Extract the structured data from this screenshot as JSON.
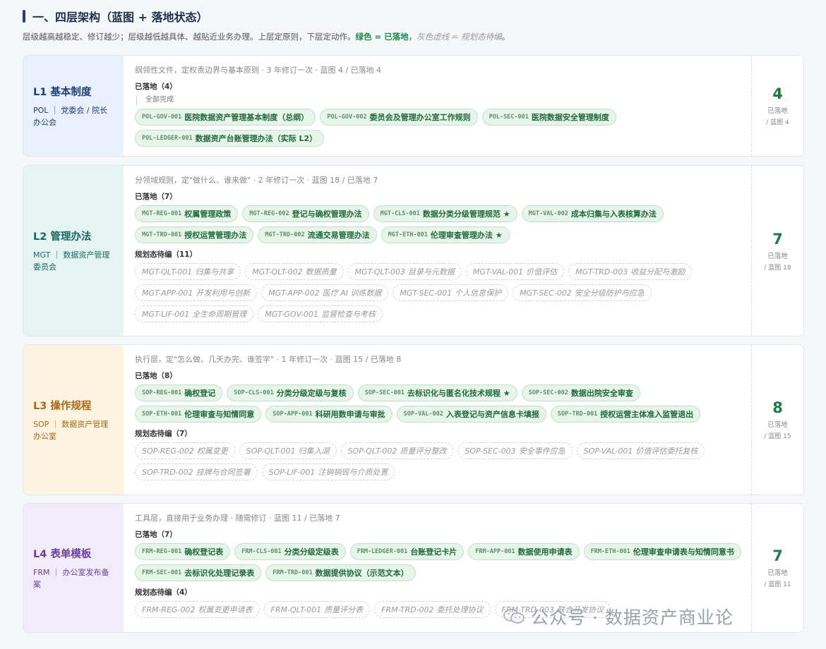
{
  "header": {
    "title": "一、四层架构（蓝图 + 落地状态）",
    "subtitle_prefix": "层级越高越稳定、修订越少；层级越低越具体、越贴近业务办理。上层定原则，下层定动作。",
    "subtitle_green": "绿色 = 已落地",
    "subtitle_sep": "，",
    "subtitle_gray": "灰色虚线 = 规划态待编",
    "subtitle_end": "。"
  },
  "colors": {
    "l1_bg": "#eaf0fb",
    "l1_fg": "#1f3f7a",
    "l2_bg": "#e6f4f1",
    "l2_fg": "#17695e",
    "l3_bg": "#fdf3e1",
    "l3_fg": "#a6691a",
    "l4_bg": "#f1ecf7",
    "l4_fg": "#6b3f9a",
    "done_green": "#1e7a45"
  },
  "layers": [
    {
      "name": "L1 基本制度",
      "owner": "POL ｜ 党委会 / 院长办公会",
      "desc": "纲领性文件，定权责边界与基本原则 · 3 年修订一次 · 蓝图 4 / 已落地 4",
      "done_label": "已落地（4）",
      "note": "全部完成",
      "done": [
        {
          "code": "POL-GOV-001",
          "name": "医院数据资产管理基本制度（总纲）"
        },
        {
          "code": "POL-GOV-002",
          "name": "委员会及管理办公室工作规则"
        },
        {
          "code": "POL-SEC-001",
          "name": "医院数据安全管理制度"
        },
        {
          "code": "POL-LEDGER-001",
          "name": "数据资产台账管理办法（实际 L2）"
        }
      ],
      "plan_label": "",
      "plan": [],
      "stat_num": "4",
      "stat_l1": "已落地",
      "stat_l2": "/ 蓝图 4"
    },
    {
      "name": "L2 管理办法",
      "owner": "MGT ｜ 数据资产管理委员会",
      "desc": "分领域规则，定\"做什么、谁来做\" · 2 年修订一次 · 蓝图 18 / 已落地 7",
      "done_label": "已落地（7）",
      "note": "",
      "done": [
        {
          "code": "MGT-REG-001",
          "name": "权属管理政策"
        },
        {
          "code": "MGT-REG-002",
          "name": "登记与确权管理办法"
        },
        {
          "code": "MGT-CLS-001",
          "name": "数据分类分级管理规范 ★"
        },
        {
          "code": "MGT-VAL-002",
          "name": "成本归集与入表核算办法"
        },
        {
          "code": "MGT-TRD-001",
          "name": "授权运营管理办法"
        },
        {
          "code": "MGT-TRD-002",
          "name": "流通交易管理办法"
        },
        {
          "code": "MGT-ETH-001",
          "name": "伦理审查管理办法 ★"
        }
      ],
      "plan_label": "规划态待编（11）",
      "plan": [
        {
          "code": "MGT-QLT-001",
          "name": "归集与共享"
        },
        {
          "code": "MGT-QLT-002",
          "name": "数据质量"
        },
        {
          "code": "MGT-QLT-003",
          "name": "目录与元数据"
        },
        {
          "code": "MGT-VAL-001",
          "name": "价值评估"
        },
        {
          "code": "MGT-TRD-003",
          "name": "收益分配与激励"
        },
        {
          "code": "MGT-APP-001",
          "name": "开发利用与创新"
        },
        {
          "code": "MGT-APP-002",
          "name": "医疗 AI 训练数据"
        },
        {
          "code": "MGT-SEC-001",
          "name": "个人信息保护"
        },
        {
          "code": "MGT-SEC-002",
          "name": "安全分级防护与应急"
        },
        {
          "code": "MGT-LIF-001",
          "name": "全生命周期管理"
        },
        {
          "code": "MGT-GOV-001",
          "name": "监督检查与考核"
        }
      ],
      "stat_num": "7",
      "stat_l1": "已落地",
      "stat_l2": "/ 蓝图 18"
    },
    {
      "name": "L3 操作规程",
      "owner": "SOP ｜ 数据资产管理办公室",
      "desc": "执行层，定\"怎么做、几天办完、谁签字\" · 1 年修订一次 · 蓝图 15 / 已落地 8",
      "done_label": "已落地（8）",
      "note": "",
      "done": [
        {
          "code": "SOP-REG-001",
          "name": "确权登记"
        },
        {
          "code": "SOP-CLS-001",
          "name": "分类分级定级与复核"
        },
        {
          "code": "SOP-SEC-001",
          "name": "去标识化与匿名化技术规程 ★"
        },
        {
          "code": "SOP-SEC-002",
          "name": "数据出院安全审查"
        },
        {
          "code": "SOP-ETH-001",
          "name": "伦理审查与知情同意"
        },
        {
          "code": "SOP-APP-001",
          "name": "科研用数申请与审批"
        },
        {
          "code": "SOP-VAL-002",
          "name": "入表登记与资产信息卡填报"
        },
        {
          "code": "SOP-TRD-001",
          "name": "授权运营主体准入监管退出"
        }
      ],
      "plan_label": "规划态待编（7）",
      "plan": [
        {
          "code": "SOP-REG-002",
          "name": "权属变更"
        },
        {
          "code": "SOP-QLT-001",
          "name": "归集入湖"
        },
        {
          "code": "SOP-QLT-002",
          "name": "质量评分整改"
        },
        {
          "code": "SOP-SEC-003",
          "name": "安全事件应急"
        },
        {
          "code": "SOP-VAL-001",
          "name": "价值评估委托复核"
        },
        {
          "code": "SOP-TRD-002",
          "name": "挂牌与合同签署"
        },
        {
          "code": "SOP-LIF-001",
          "name": "注销销毁与介质处置"
        }
      ],
      "stat_num": "8",
      "stat_l1": "已落地",
      "stat_l2": "/ 蓝图 15"
    },
    {
      "name": "L4 表单模板",
      "owner": "FRM ｜ 办公室发布备案",
      "desc": "工具层，直接用于业务办理 · 随需修订 · 蓝图 11 / 已落地 7",
      "done_label": "已落地（7）",
      "note": "",
      "done": [
        {
          "code": "FRM-REG-001",
          "name": "确权登记表"
        },
        {
          "code": "FRM-CLS-001",
          "name": "分类分级定级表"
        },
        {
          "code": "FRM-LEDGER-001",
          "name": "台账登记卡片"
        },
        {
          "code": "FRM-APP-001",
          "name": "数据使用申请表"
        },
        {
          "code": "FRM-ETH-001",
          "name": "伦理审查申请表与知情同意书"
        },
        {
          "code": "FRM-SEC-001",
          "name": "去标识化处理记录表"
        },
        {
          "code": "FRM-TRD-001",
          "name": "数据提供协议（示范文本）"
        }
      ],
      "plan_label": "规划态待编（4）",
      "plan": [
        {
          "code": "FRM-REG-002",
          "name": "权属变更申请表"
        },
        {
          "code": "FRM-QLT-001",
          "name": "质量评分表"
        },
        {
          "code": "FRM-TRD-002",
          "name": "委托处理协议"
        },
        {
          "code": "FRM-TRD-003",
          "name": "联合开发协议"
        }
      ],
      "stat_num": "7",
      "stat_l1": "已落地",
      "stat_l2": "/ 蓝图 11"
    }
  ],
  "watermark": {
    "text": "公众号 · 数据资产商业论",
    "icon": "wechat-icon"
  }
}
